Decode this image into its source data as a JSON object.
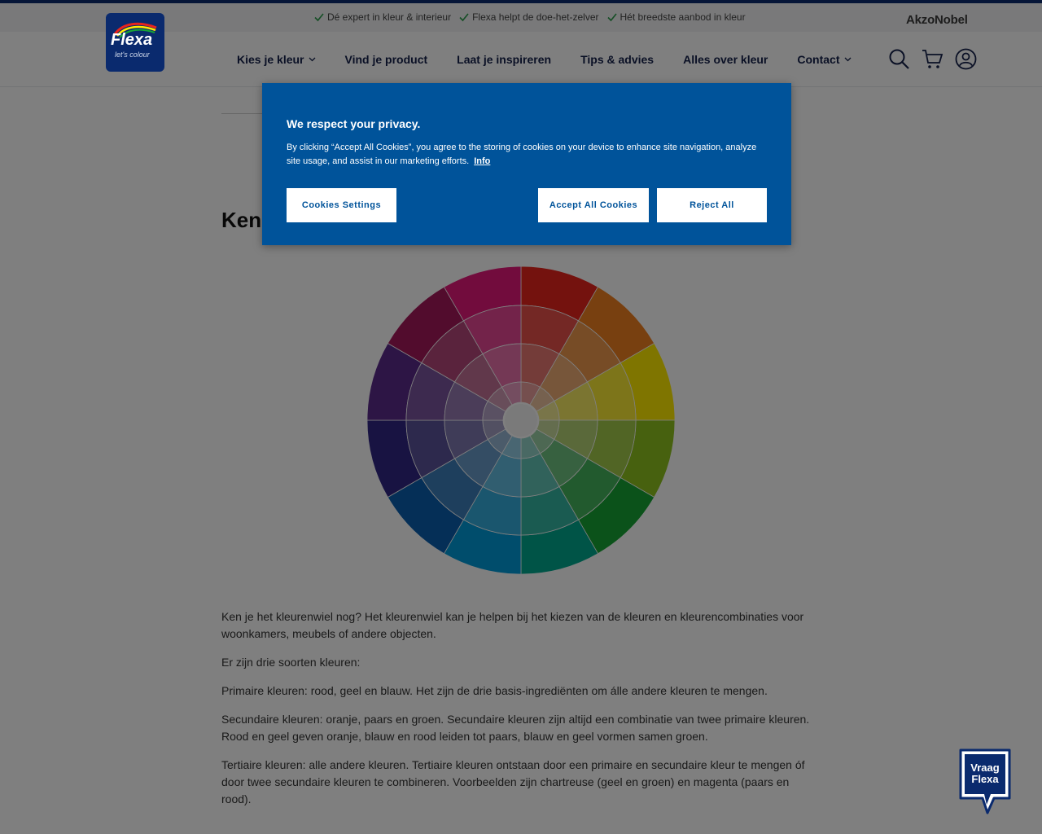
{
  "usp_bar": {
    "items": [
      "Dé expert in kleur & interieur",
      "Flexa helpt de doe-het-zelver",
      "Hét breedste aanbod in kleur"
    ],
    "brand": "AkzoNobel"
  },
  "logo": {
    "name": "Flexa",
    "tagline": "let's colour"
  },
  "nav": {
    "items": [
      {
        "label": "Kies je kleur",
        "has_dropdown": true
      },
      {
        "label": "Vind je product",
        "has_dropdown": false
      },
      {
        "label": "Laat je inspireren",
        "has_dropdown": false
      },
      {
        "label": "Tips & advies",
        "has_dropdown": false
      },
      {
        "label": "Alles over kleur",
        "has_dropdown": false
      },
      {
        "label": "Contact",
        "has_dropdown": true
      }
    ]
  },
  "header_icons": [
    "search-icon",
    "cart-icon",
    "account-icon"
  ],
  "page": {
    "title_partial": "Ken",
    "paragraphs": [
      "Ken je het kleurenwiel nog? Het kleurenwiel kan je helpen bij het kiezen van de kleuren en kleurencombinaties voor woonkamers, meubels of andere objecten.",
      "Er zijn drie soorten kleuren:",
      "Primaire kleuren: rood, geel en blauw. Het zijn de drie basis-ingrediënten om álle andere kleuren te mengen.",
      "Secundaire kleuren: oranje, paars en groen. Secundaire kleuren zijn altijd een combinatie van twee primaire kleuren. Rood en geel geven oranje, blauw en rood leiden tot paars, blauw en geel vormen samen groen.",
      "Tertiaire kleuren: alle andere kleuren. Tertiaire kleuren ontstaan door een primaire en secundaire kleur te mengen óf door twee secundaire kleuren te combineren. Voorbeelden zijn chartreuse (geel en groen) en magenta (paars en rood)."
    ]
  },
  "color_wheel": {
    "segments": 12,
    "rings": 4,
    "hues": [
      "#e8241c",
      "#f08020",
      "#ffeb00",
      "#8ec21e",
      "#16a535",
      "#00a88f",
      "#009ad8",
      "#0a5fae",
      "#312785",
      "#5a2a8a",
      "#a5195b",
      "#e5187b"
    ]
  },
  "cookie_banner": {
    "title": "We respect your privacy.",
    "text": "By clicking “Accept All Cookies”, you agree to the storing of cookies on your device to enhance site navigation, analyze site usage, and assist in our marketing efforts.",
    "link": "Info",
    "settings_button": "Cookies Settings",
    "accept_button": "Accept All Cookies",
    "reject_button": "Reject All"
  },
  "chat_widget": {
    "line1": "Vraag",
    "line2": "Flexa"
  },
  "colors": {
    "brand_navy": "#0a2a6e",
    "cookie_blue": "#00539a",
    "check_green": "#2a9d4a"
  }
}
